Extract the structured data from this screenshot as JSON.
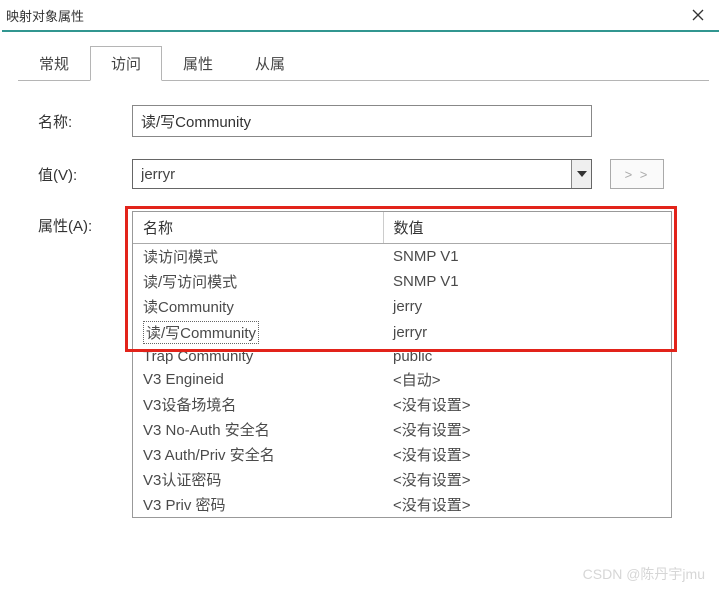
{
  "window": {
    "title": "映射对象属性"
  },
  "tabs": [
    {
      "label": "常规"
    },
    {
      "label": "访问"
    },
    {
      "label": "属性"
    },
    {
      "label": "从属"
    }
  ],
  "form": {
    "name_label": "名称:",
    "name_value": "读/写Community",
    "value_label": "值(V):",
    "value_value": "jerryr",
    "set_button": "> >",
    "attr_label": "属性(A):"
  },
  "table": {
    "headers": {
      "name": "名称",
      "value": "数值"
    },
    "rows": [
      {
        "name": "读访问模式",
        "value": "SNMP V1"
      },
      {
        "name": "读/写访问模式",
        "value": "SNMP V1"
      },
      {
        "name": "读Community",
        "value": "jerry"
      },
      {
        "name": "读/写Community",
        "value": "jerryr",
        "selected": true
      },
      {
        "name": "Trap Community",
        "value": "public"
      },
      {
        "name": "V3 Engineid",
        "value": "<自动>"
      },
      {
        "name": "V3设备场境名",
        "value": "<没有设置>"
      },
      {
        "name": "V3 No-Auth 安全名",
        "value": "<没有设置>"
      },
      {
        "name": "V3 Auth/Priv 安全名",
        "value": "<没有设置>"
      },
      {
        "name": "V3认证密码",
        "value": "<没有设置>"
      },
      {
        "name": "V3 Priv 密码",
        "value": "<没有设置>"
      }
    ]
  },
  "watermark": "CSDN @陈丹宇jmu"
}
